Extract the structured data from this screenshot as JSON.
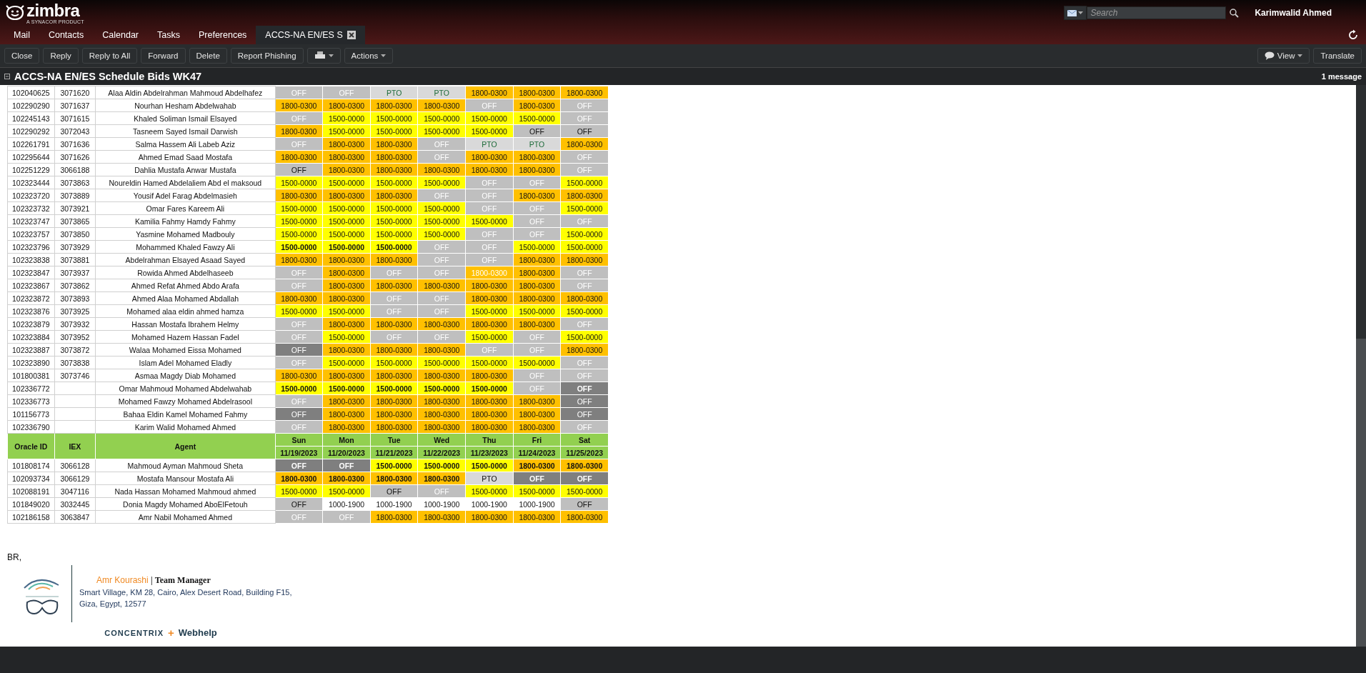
{
  "app": {
    "logo": "zimbra",
    "logo_tagline": "A SYNACOR PRODUCT",
    "search": {
      "placeholder": "Search"
    },
    "user": "Karimwalid Ahmed"
  },
  "tabs": [
    {
      "label": "Mail",
      "selected": false,
      "closable": false
    },
    {
      "label": "Contacts",
      "selected": false,
      "closable": false
    },
    {
      "label": "Calendar",
      "selected": false,
      "closable": false
    },
    {
      "label": "Tasks",
      "selected": false,
      "closable": false
    },
    {
      "label": "Preferences",
      "selected": false,
      "closable": false
    },
    {
      "label": "ACCS-NA EN/ES S",
      "selected": true,
      "closable": true
    }
  ],
  "toolbar": {
    "left": [
      {
        "label": "Close",
        "kind": "text"
      },
      {
        "label": "Reply",
        "kind": "text"
      },
      {
        "label": "Reply to All",
        "kind": "text"
      },
      {
        "label": "Forward",
        "kind": "text"
      },
      {
        "label": "Delete",
        "kind": "text"
      },
      {
        "label": "Report Phishing",
        "kind": "text"
      },
      {
        "kind": "print"
      },
      {
        "label": "Actions",
        "kind": "menu"
      }
    ],
    "right": [
      {
        "label": "View",
        "kind": "view"
      },
      {
        "label": "Translate",
        "kind": "text"
      }
    ]
  },
  "subject": "ACCS-NA EN/ES Schedule Bids WK47",
  "message_count": "1 message",
  "schedule": {
    "header": {
      "oracle_id": "Oracle ID",
      "iex": "IEX",
      "agent": "Agent",
      "days": [
        {
          "day": "Sun",
          "date": "11/19/2023"
        },
        {
          "day": "Mon",
          "date": "11/20/2023"
        },
        {
          "day": "Tue",
          "date": "11/21/2023"
        },
        {
          "day": "Wed",
          "date": "11/22/2023"
        },
        {
          "day": "Thu",
          "date": "11/23/2023"
        },
        {
          "day": "Fri",
          "date": "11/24/2023"
        },
        {
          "day": "Sat",
          "date": "11/25/2023"
        }
      ]
    },
    "rows_top": [
      {
        "oracle_id": "102040625",
        "iex": "3071620",
        "agent": "Alaa Aldin Abdelrahman Mahmoud Abdelhafez",
        "shifts": [
          {
            "text": "OFF",
            "kind": "off"
          },
          {
            "text": "OFF",
            "kind": "off"
          },
          {
            "text": "PTO",
            "kind": "pto"
          },
          {
            "text": "PTO",
            "kind": "pto"
          },
          {
            "text": "1800-0300",
            "kind": "evening"
          },
          {
            "text": "1800-0300",
            "kind": "evening"
          },
          {
            "text": "1800-0300",
            "kind": "evening"
          }
        ]
      },
      {
        "oracle_id": "102290290",
        "iex": "3071637",
        "agent": "Nourhan Hesham Abdelwahab",
        "shifts": [
          {
            "text": "1800-0300",
            "kind": "evening"
          },
          {
            "text": "1800-0300",
            "kind": "evening"
          },
          {
            "text": "1800-0300",
            "kind": "evening"
          },
          {
            "text": "1800-0300",
            "kind": "evening"
          },
          {
            "text": "OFF",
            "kind": "off"
          },
          {
            "text": "1800-0300",
            "kind": "evening"
          },
          {
            "text": "OFF",
            "kind": "off"
          }
        ]
      },
      {
        "oracle_id": "102245143",
        "iex": "3071615",
        "agent": "Khaled Soliman Ismail Elsayed",
        "shifts": [
          {
            "text": "OFF",
            "kind": "off"
          },
          {
            "text": "1500-0000",
            "kind": "day"
          },
          {
            "text": "1500-0000",
            "kind": "day"
          },
          {
            "text": "1500-0000",
            "kind": "day"
          },
          {
            "text": "1500-0000",
            "kind": "day"
          },
          {
            "text": "1500-0000",
            "kind": "day"
          },
          {
            "text": "OFF",
            "kind": "off"
          }
        ]
      },
      {
        "oracle_id": "102290292",
        "iex": "3072043",
        "agent": "Tasneem Sayed Ismail Darwish",
        "shifts": [
          {
            "text": "1800-0300",
            "kind": "evening"
          },
          {
            "text": "1500-0000",
            "kind": "day"
          },
          {
            "text": "1500-0000",
            "kind": "day"
          },
          {
            "text": "1500-0000",
            "kind": "day"
          },
          {
            "text": "1500-0000",
            "kind": "day"
          },
          {
            "text": "OFF",
            "kind": "offblack"
          },
          {
            "text": "OFF",
            "kind": "offblack"
          }
        ]
      },
      {
        "oracle_id": "102261791",
        "iex": "3071636",
        "agent": "Salma Hassem Ali Labeb Aziz",
        "shifts": [
          {
            "text": "OFF",
            "kind": "off"
          },
          {
            "text": "1800-0300",
            "kind": "evening"
          },
          {
            "text": "1800-0300",
            "kind": "evening"
          },
          {
            "text": "OFF",
            "kind": "off"
          },
          {
            "text": "PTO",
            "kind": "pto"
          },
          {
            "text": "PTO",
            "kind": "pto"
          },
          {
            "text": "1800-0300",
            "kind": "evening"
          }
        ]
      },
      {
        "oracle_id": "102295644",
        "iex": "3071626",
        "agent": "Ahmed Emad Saad Mostafa",
        "shifts": [
          {
            "text": "1800-0300",
            "kind": "evening"
          },
          {
            "text": "1800-0300",
            "kind": "evening"
          },
          {
            "text": "1800-0300",
            "kind": "evening"
          },
          {
            "text": "OFF",
            "kind": "off"
          },
          {
            "text": "1800-0300",
            "kind": "evening"
          },
          {
            "text": "1800-0300",
            "kind": "evening"
          },
          {
            "text": "OFF",
            "kind": "off"
          }
        ]
      },
      {
        "oracle_id": "102251229",
        "iex": "3066188",
        "agent": "Dahlia Mustafa Anwar Mustafa",
        "shifts": [
          {
            "text": "OFF",
            "kind": "offblack"
          },
          {
            "text": "1800-0300",
            "kind": "evening"
          },
          {
            "text": "1800-0300",
            "kind": "evening"
          },
          {
            "text": "1800-0300",
            "kind": "evening"
          },
          {
            "text": "1800-0300",
            "kind": "evening"
          },
          {
            "text": "1800-0300",
            "kind": "evening"
          },
          {
            "text": "OFF",
            "kind": "off"
          }
        ]
      },
      {
        "oracle_id": "102323444",
        "iex": "3073863",
        "agent": "Noureldin Hamed Abdelaliem Abd el maksoud",
        "shifts": [
          {
            "text": "1500-0000",
            "kind": "day"
          },
          {
            "text": "1500-0000",
            "kind": "day"
          },
          {
            "text": "1500-0000",
            "kind": "day"
          },
          {
            "text": "1500-0000",
            "kind": "day"
          },
          {
            "text": "OFF",
            "kind": "off"
          },
          {
            "text": "OFF",
            "kind": "off"
          },
          {
            "text": "1500-0000",
            "kind": "day"
          }
        ]
      },
      {
        "oracle_id": "102323720",
        "iex": "3073889",
        "agent": "Yousif Adel Farag Abdelmasieh",
        "shifts": [
          {
            "text": "1800-0300",
            "kind": "evening"
          },
          {
            "text": "1800-0300",
            "kind": "evening"
          },
          {
            "text": "1800-0300",
            "kind": "evening"
          },
          {
            "text": "OFF",
            "kind": "off"
          },
          {
            "text": "OFF",
            "kind": "off"
          },
          {
            "text": "1800-0300",
            "kind": "evening"
          },
          {
            "text": "1800-0300",
            "kind": "evening"
          }
        ]
      },
      {
        "oracle_id": "102323732",
        "iex": "3073921",
        "agent": "Omar Fares Kareem Ali",
        "shifts": [
          {
            "text": "1500-0000",
            "kind": "day"
          },
          {
            "text": "1500-0000",
            "kind": "day"
          },
          {
            "text": "1500-0000",
            "kind": "day"
          },
          {
            "text": "1500-0000",
            "kind": "day"
          },
          {
            "text": "OFF",
            "kind": "off"
          },
          {
            "text": "OFF",
            "kind": "off"
          },
          {
            "text": "1500-0000",
            "kind": "day"
          }
        ]
      },
      {
        "oracle_id": "102323747",
        "iex": "3073865",
        "agent": "Kamilia Fahmy Hamdy Fahmy",
        "shifts": [
          {
            "text": "1500-0000",
            "kind": "day"
          },
          {
            "text": "1500-0000",
            "kind": "day"
          },
          {
            "text": "1500-0000",
            "kind": "day"
          },
          {
            "text": "1500-0000",
            "kind": "day"
          },
          {
            "text": "1500-0000",
            "kind": "day"
          },
          {
            "text": "OFF",
            "kind": "off"
          },
          {
            "text": "OFF",
            "kind": "off"
          }
        ]
      },
      {
        "oracle_id": "102323757",
        "iex": "3073850",
        "agent": "Yasmine Mohamed Madbouly",
        "shifts": [
          {
            "text": "1500-0000",
            "kind": "day"
          },
          {
            "text": "1500-0000",
            "kind": "day"
          },
          {
            "text": "1500-0000",
            "kind": "day"
          },
          {
            "text": "1500-0000",
            "kind": "day"
          },
          {
            "text": "OFF",
            "kind": "off"
          },
          {
            "text": "OFF",
            "kind": "off"
          },
          {
            "text": "1500-0000",
            "kind": "day"
          }
        ]
      },
      {
        "oracle_id": "102323796",
        "iex": "3073929",
        "agent": "Mohammed Khaled Fawzy Ali",
        "shifts": [
          {
            "text": "1500-0000",
            "kind": "daybold"
          },
          {
            "text": "1500-0000",
            "kind": "daybold"
          },
          {
            "text": "1500-0000",
            "kind": "daybold"
          },
          {
            "text": "OFF",
            "kind": "off"
          },
          {
            "text": "OFF",
            "kind": "off"
          },
          {
            "text": "1500-0000",
            "kind": "day"
          },
          {
            "text": "1500-0000",
            "kind": "day"
          }
        ]
      },
      {
        "oracle_id": "102323838",
        "iex": "3073881",
        "agent": "Abdelrahman Elsayed Asaad Sayed",
        "shifts": [
          {
            "text": "1800-0300",
            "kind": "evening"
          },
          {
            "text": "1800-0300",
            "kind": "evening"
          },
          {
            "text": "1800-0300",
            "kind": "evening"
          },
          {
            "text": "OFF",
            "kind": "off"
          },
          {
            "text": "OFF",
            "kind": "off"
          },
          {
            "text": "1800-0300",
            "kind": "evening"
          },
          {
            "text": "1800-0300",
            "kind": "evening"
          }
        ]
      },
      {
        "oracle_id": "102323847",
        "iex": "3073937",
        "agent": "Rowida Ahmed Abdelhaseeb",
        "shifts": [
          {
            "text": "OFF",
            "kind": "off"
          },
          {
            "text": "1800-0300",
            "kind": "evening"
          },
          {
            "text": "OFF",
            "kind": "off"
          },
          {
            "text": "OFF",
            "kind": "off"
          },
          {
            "text": "1800-0300",
            "kind": "eveningwhite"
          },
          {
            "text": "1800-0300",
            "kind": "evening"
          },
          {
            "text": "OFF",
            "kind": "off"
          }
        ]
      },
      {
        "oracle_id": "102323867",
        "iex": "3073862",
        "agent": "Ahmed Refat Ahmed Abdo Arafa",
        "shifts": [
          {
            "text": "OFF",
            "kind": "off"
          },
          {
            "text": "1800-0300",
            "kind": "evening"
          },
          {
            "text": "1800-0300",
            "kind": "evening"
          },
          {
            "text": "1800-0300",
            "kind": "evening"
          },
          {
            "text": "1800-0300",
            "kind": "evening"
          },
          {
            "text": "1800-0300",
            "kind": "evening"
          },
          {
            "text": "OFF",
            "kind": "off"
          }
        ]
      },
      {
        "oracle_id": "102323872",
        "iex": "3073893",
        "agent": "Ahmed Alaa Mohamed Abdallah",
        "shifts": [
          {
            "text": "1800-0300",
            "kind": "evening"
          },
          {
            "text": "1800-0300",
            "kind": "evening"
          },
          {
            "text": "OFF",
            "kind": "off"
          },
          {
            "text": "OFF",
            "kind": "off"
          },
          {
            "text": "1800-0300",
            "kind": "evening"
          },
          {
            "text": "1800-0300",
            "kind": "evening"
          },
          {
            "text": "1800-0300",
            "kind": "evening"
          }
        ]
      },
      {
        "oracle_id": "102323876",
        "iex": "3073925",
        "agent": "Mohamed alaa eldin ahmed hamza",
        "shifts": [
          {
            "text": "1500-0000",
            "kind": "day"
          },
          {
            "text": "1500-0000",
            "kind": "day"
          },
          {
            "text": "OFF",
            "kind": "off"
          },
          {
            "text": "OFF",
            "kind": "off"
          },
          {
            "text": "1500-0000",
            "kind": "day"
          },
          {
            "text": "1500-0000",
            "kind": "day"
          },
          {
            "text": "1500-0000",
            "kind": "day"
          }
        ]
      },
      {
        "oracle_id": "102323879",
        "iex": "3073932",
        "agent": "Hassan Mostafa Ibrahem Helmy",
        "shifts": [
          {
            "text": "OFF",
            "kind": "off"
          },
          {
            "text": "1800-0300",
            "kind": "evening"
          },
          {
            "text": "1800-0300",
            "kind": "evening"
          },
          {
            "text": "1800-0300",
            "kind": "evening"
          },
          {
            "text": "1800-0300",
            "kind": "evening"
          },
          {
            "text": "1800-0300",
            "kind": "evening"
          },
          {
            "text": "OFF",
            "kind": "off"
          }
        ]
      },
      {
        "oracle_id": "102323884",
        "iex": "3073952",
        "agent": "Mohamed Hazem Hassan Fadel",
        "shifts": [
          {
            "text": "OFF",
            "kind": "off"
          },
          {
            "text": "1500-0000",
            "kind": "day"
          },
          {
            "text": "OFF",
            "kind": "off"
          },
          {
            "text": "OFF",
            "kind": "off"
          },
          {
            "text": "1500-0000",
            "kind": "day"
          },
          {
            "text": "OFF",
            "kind": "off"
          },
          {
            "text": "1500-0000",
            "kind": "day"
          }
        ]
      },
      {
        "oracle_id": "102323887",
        "iex": "3073872",
        "agent": "Walaa Mohamed Eissa Mohamed",
        "shifts": [
          {
            "text": "OFF",
            "kind": "offdark"
          },
          {
            "text": "1800-0300",
            "kind": "evening"
          },
          {
            "text": "1800-0300",
            "kind": "evening"
          },
          {
            "text": "1800-0300",
            "kind": "evening"
          },
          {
            "text": "OFF",
            "kind": "off"
          },
          {
            "text": "OFF",
            "kind": "off"
          },
          {
            "text": "1800-0300",
            "kind": "evening"
          }
        ]
      },
      {
        "oracle_id": "102323890",
        "iex": "3073838",
        "agent": "Islam Adel Mohamed Eladly",
        "shifts": [
          {
            "text": "OFF",
            "kind": "off"
          },
          {
            "text": "1500-0000",
            "kind": "day"
          },
          {
            "text": "1500-0000",
            "kind": "day"
          },
          {
            "text": "1500-0000",
            "kind": "day"
          },
          {
            "text": "1500-0000",
            "kind": "day"
          },
          {
            "text": "1500-0000",
            "kind": "day"
          },
          {
            "text": "OFF",
            "kind": "off"
          }
        ]
      },
      {
        "oracle_id": "101800381",
        "iex": "3073746",
        "agent": "Asmaa Magdy Diab Mohamed",
        "shifts": [
          {
            "text": "1800-0300",
            "kind": "evening"
          },
          {
            "text": "1800-0300",
            "kind": "evening"
          },
          {
            "text": "1800-0300",
            "kind": "evening"
          },
          {
            "text": "1800-0300",
            "kind": "evening"
          },
          {
            "text": "1800-0300",
            "kind": "evening"
          },
          {
            "text": "OFF",
            "kind": "off"
          },
          {
            "text": "OFF",
            "kind": "off"
          }
        ]
      },
      {
        "oracle_id": "102336772",
        "agent": "Omar Mahmoud Mohamed Abdelwahab",
        "shifts": [
          {
            "text": "1500-0000",
            "kind": "daybold"
          },
          {
            "text": "1500-0000",
            "kind": "daybold"
          },
          {
            "text": "1500-0000",
            "kind": "daybold"
          },
          {
            "text": "1500-0000",
            "kind": "daybold"
          },
          {
            "text": "1500-0000",
            "kind": "daybold"
          },
          {
            "text": "OFF",
            "kind": "off"
          },
          {
            "text": "OFF",
            "kind": "offdarkbold"
          }
        ]
      },
      {
        "oracle_id": "102336773",
        "agent": "Mohamed Fawzy Mohamed Abdelrasool",
        "shifts": [
          {
            "text": "OFF",
            "kind": "off"
          },
          {
            "text": "1800-0300",
            "kind": "evening"
          },
          {
            "text": "1800-0300",
            "kind": "evening"
          },
          {
            "text": "1800-0300",
            "kind": "evening"
          },
          {
            "text": "1800-0300",
            "kind": "evening"
          },
          {
            "text": "1800-0300",
            "kind": "evening"
          },
          {
            "text": "OFF",
            "kind": "offdark"
          }
        ]
      },
      {
        "oracle_id": "101156773",
        "agent": "Bahaa Eldin Kamel Mohamed Fahmy",
        "shifts": [
          {
            "text": "OFF",
            "kind": "offdark"
          },
          {
            "text": "1800-0300",
            "kind": "evening"
          },
          {
            "text": "1800-0300",
            "kind": "evening"
          },
          {
            "text": "1800-0300",
            "kind": "evening"
          },
          {
            "text": "1800-0300",
            "kind": "evening"
          },
          {
            "text": "1800-0300",
            "kind": "evening"
          },
          {
            "text": "OFF",
            "kind": "offdark"
          }
        ]
      },
      {
        "oracle_id": "102336790",
        "agent": "Karim Walid Mohamed Ahmed",
        "shifts": [
          {
            "text": "OFF",
            "kind": "off"
          },
          {
            "text": "1800-0300",
            "kind": "evening"
          },
          {
            "text": "1800-0300",
            "kind": "evening"
          },
          {
            "text": "1800-0300",
            "kind": "evening"
          },
          {
            "text": "1800-0300",
            "kind": "evening"
          },
          {
            "text": "1800-0300",
            "kind": "evening"
          },
          {
            "text": "OFF",
            "kind": "off"
          }
        ]
      }
    ],
    "rows_bottom": [
      {
        "oracle_id": "101808174",
        "iex": "3066128",
        "agent": "Mahmoud Ayman Mahmoud Sheta",
        "shifts": [
          {
            "text": "OFF",
            "kind": "offdarkbold"
          },
          {
            "text": "OFF",
            "kind": "offdarkbold"
          },
          {
            "text": "1500-0000",
            "kind": "daybold"
          },
          {
            "text": "1500-0000",
            "kind": "daybold"
          },
          {
            "text": "1500-0000",
            "kind": "daybold"
          },
          {
            "text": "1800-0300",
            "kind": "eveningbold"
          },
          {
            "text": "1800-0300",
            "kind": "eveningbold"
          }
        ]
      },
      {
        "oracle_id": "102093734",
        "iex": "3066129",
        "agent": "Mostafa Mansour Mostafa Ali",
        "shifts": [
          {
            "text": "1800-0300",
            "kind": "eveningbold"
          },
          {
            "text": "1800-0300",
            "kind": "eveningbold"
          },
          {
            "text": "1800-0300",
            "kind": "eveningbold"
          },
          {
            "text": "1800-0300",
            "kind": "eveningbold"
          },
          {
            "text": "PTO",
            "kind": "ptoblack"
          },
          {
            "text": "OFF",
            "kind": "offdarkbold"
          },
          {
            "text": "OFF",
            "kind": "offdarkbold"
          }
        ]
      },
      {
        "oracle_id": "102088191",
        "iex": "3047116",
        "agent": "Nada Hassan Mohamed Mahmoud ahmed",
        "shifts": [
          {
            "text": "1500-0000",
            "kind": "day"
          },
          {
            "text": "1500-0000",
            "kind": "day"
          },
          {
            "text": "OFF",
            "kind": "offblack"
          },
          {
            "text": "OFF",
            "kind": "off"
          },
          {
            "text": "1500-0000",
            "kind": "day"
          },
          {
            "text": "1500-0000",
            "kind": "day"
          },
          {
            "text": "1500-0000",
            "kind": "day"
          }
        ]
      },
      {
        "oracle_id": "101849020",
        "iex": "3032445",
        "agent": "Donia Magdy Mohamed AboElFetouh",
        "shifts": [
          {
            "text": "OFF",
            "kind": "offblack"
          },
          {
            "text": "1000-1900",
            "kind": "plain"
          },
          {
            "text": "1000-1900",
            "kind": "plain"
          },
          {
            "text": "1000-1900",
            "kind": "plain"
          },
          {
            "text": "1000-1900",
            "kind": "plain"
          },
          {
            "text": "1000-1900",
            "kind": "plain"
          },
          {
            "text": "OFF",
            "kind": "offblack"
          }
        ]
      },
      {
        "oracle_id": "102186158",
        "iex": "3063847",
        "agent": "Amr Nabil Mohamed Ahmed",
        "shifts": [
          {
            "text": "OFF",
            "kind": "off"
          },
          {
            "text": "OFF",
            "kind": "off"
          },
          {
            "text": "1800-0300",
            "kind": "evening"
          },
          {
            "text": "1800-0300",
            "kind": "evening"
          },
          {
            "text": "1800-0300",
            "kind": "evening"
          },
          {
            "text": "1800-0300",
            "kind": "evening"
          },
          {
            "text": "1800-0300",
            "kind": "evening"
          }
        ]
      }
    ]
  },
  "closing": "BR,",
  "signature": {
    "name": "Amr Kourashi",
    "separator": "|",
    "title": "Team Manager",
    "address": "Smart Village, KM 28, Cairo, Alex Desert Road, Building F15, Giza, Egypt, 12577",
    "brand": "CONCENTRIX",
    "plus": "+",
    "partner": "Webhelp"
  }
}
